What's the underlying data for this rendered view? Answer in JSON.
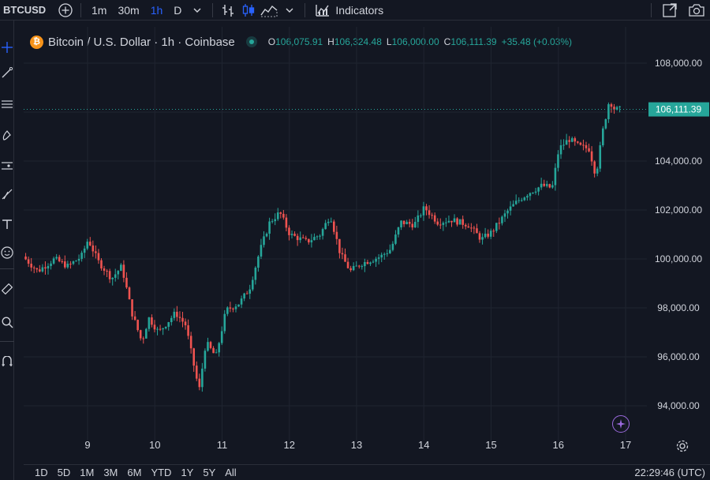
{
  "toolbar": {
    "symbol": "BTCUSD",
    "timeframes": [
      {
        "label": "1m",
        "active": false
      },
      {
        "label": "30m",
        "active": false
      },
      {
        "label": "1h",
        "active": true
      },
      {
        "label": "D",
        "active": false
      }
    ],
    "indicators_label": "Indicators"
  },
  "legend": {
    "title": "Bitcoin / U.S. Dollar · 1h · Coinbase",
    "o_label": "O",
    "o_value": "106,075.91",
    "h_label": "H",
    "h_value": "106,324.48",
    "l_label": "L",
    "l_value": "106,000.00",
    "c_label": "C",
    "c_value": "106,111.39",
    "change": "+35.48 (+0.03%)"
  },
  "price_axis": {
    "labels": [
      "108,000.00",
      "104,000.00",
      "102,000.00",
      "100,000.00",
      "98,000.00",
      "96,000.00",
      "94,000.00"
    ],
    "current_price": "106,111.39"
  },
  "time_axis": {
    "labels": [
      "9",
      "10",
      "11",
      "12",
      "13",
      "14",
      "15",
      "16",
      "17"
    ]
  },
  "bottom": {
    "ranges": [
      "1D",
      "5D",
      "1M",
      "3M",
      "6M",
      "YTD",
      "1Y",
      "5Y",
      "All"
    ],
    "clock": "22:29:46 (UTC)"
  },
  "colors": {
    "up": "#26a69a",
    "down": "#ef5350",
    "background": "#131722",
    "grid": "#1f2430",
    "accent": "#2962ff"
  },
  "chart_data": {
    "type": "candlestick",
    "timeframe": "1h",
    "x": [
      "9",
      "10",
      "11",
      "12",
      "13",
      "14",
      "15",
      "16",
      "17"
    ],
    "ylim": [
      93000,
      109000
    ],
    "anchors": [
      [
        8.08,
        100100
      ],
      [
        8.3,
        99500
      ],
      [
        8.55,
        100000
      ],
      [
        8.75,
        99700
      ],
      [
        8.95,
        100100
      ],
      [
        9.05,
        100800
      ],
      [
        9.2,
        99900
      ],
      [
        9.4,
        99200
      ],
      [
        9.55,
        99700
      ],
      [
        9.7,
        97800
      ],
      [
        9.85,
        96600
      ],
      [
        9.95,
        97600
      ],
      [
        10.1,
        97000
      ],
      [
        10.35,
        97800
      ],
      [
        10.5,
        97300
      ],
      [
        10.7,
        94600
      ],
      [
        10.8,
        96600
      ],
      [
        10.95,
        96000
      ],
      [
        11.1,
        97900
      ],
      [
        11.3,
        98200
      ],
      [
        11.45,
        98800
      ],
      [
        11.6,
        100300
      ],
      [
        11.75,
        101500
      ],
      [
        11.9,
        101900
      ],
      [
        12.05,
        101000
      ],
      [
        12.3,
        100700
      ],
      [
        12.5,
        101000
      ],
      [
        12.65,
        101800
      ],
      [
        12.8,
        100200
      ],
      [
        12.95,
        99500
      ],
      [
        13.1,
        99800
      ],
      [
        13.4,
        100100
      ],
      [
        13.55,
        100400
      ],
      [
        13.7,
        101500
      ],
      [
        13.9,
        101400
      ],
      [
        14.05,
        102100
      ],
      [
        14.25,
        101500
      ],
      [
        14.45,
        101600
      ],
      [
        14.7,
        101400
      ],
      [
        14.9,
        100800
      ],
      [
        15.05,
        101100
      ],
      [
        15.3,
        102000
      ],
      [
        15.45,
        102400
      ],
      [
        15.6,
        102700
      ],
      [
        15.8,
        103000
      ],
      [
        15.95,
        102900
      ],
      [
        16.05,
        104500
      ],
      [
        16.2,
        104900
      ],
      [
        16.35,
        104600
      ],
      [
        16.5,
        104500
      ],
      [
        16.6,
        103400
      ],
      [
        16.7,
        105200
      ],
      [
        16.8,
        106500
      ],
      [
        16.88,
        106100
      ],
      [
        16.95,
        106111
      ]
    ]
  }
}
